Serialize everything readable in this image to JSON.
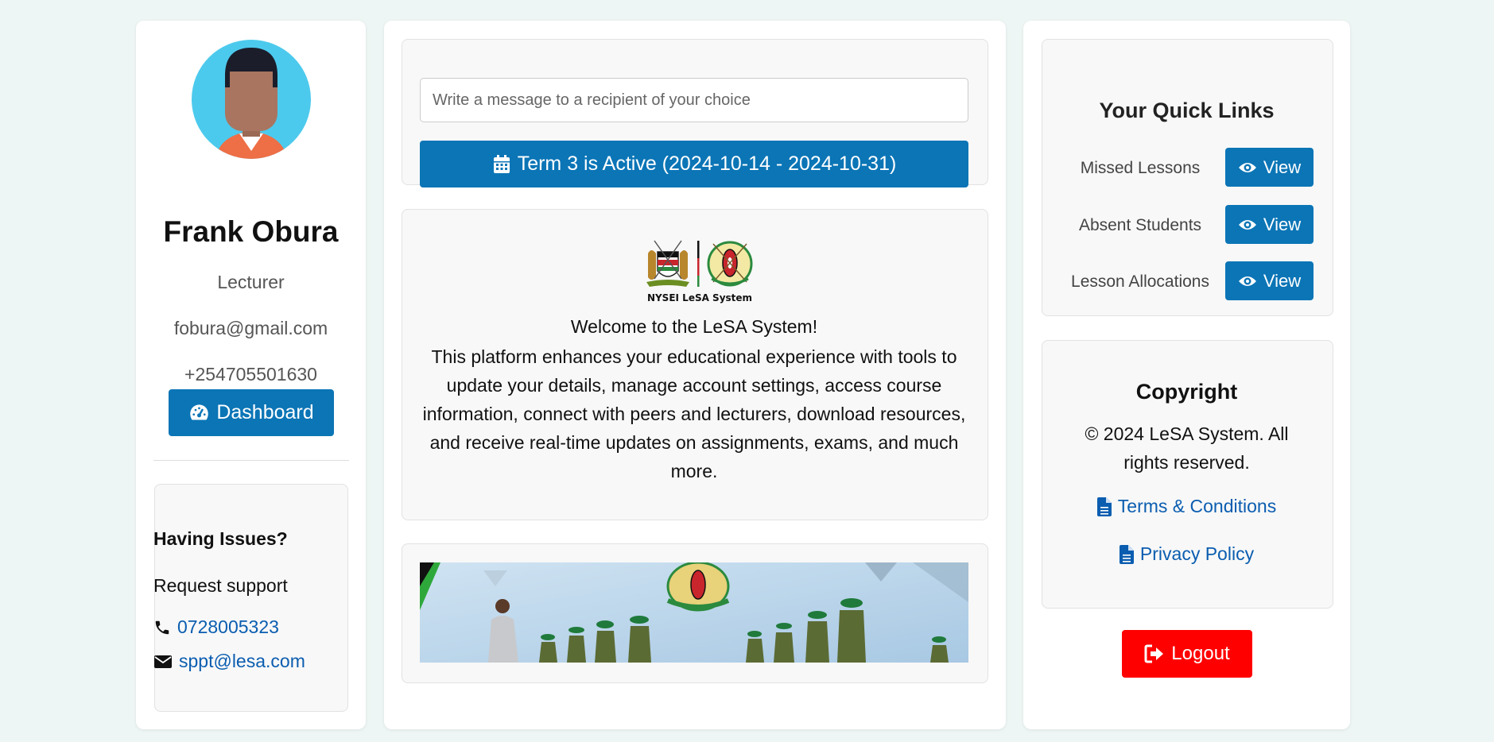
{
  "profile": {
    "name": "Frank Obura",
    "role": "Lecturer",
    "email": "fobura@gmail.com",
    "phone": "+254705501630",
    "dashboard_label": "Dashboard"
  },
  "support": {
    "title": "Having Issues?",
    "subtitle": "Request support",
    "phone": "0728005323",
    "email": "sppt@lesa.com"
  },
  "composer": {
    "placeholder": "Write a message to a recipient of your choice",
    "term_label": "Term 3 is Active (2024-10-14 - 2024-10-31)"
  },
  "welcome": {
    "logo_caption": "NYSEI LeSA System",
    "title": "Welcome to the LeSA System!",
    "body": "This platform enhances your educational experience with tools to update your details, manage account settings, access course information, connect with peers and lecturers, download resources, and receive real-time updates on assignments, exams, and much more."
  },
  "quick_links": {
    "title": "Your Quick Links",
    "items": [
      {
        "label": "Missed Lessons",
        "button": "View"
      },
      {
        "label": "Absent Students",
        "button": "View"
      },
      {
        "label": "Lesson Allocations",
        "button": "View"
      }
    ]
  },
  "copyright": {
    "title": "Copyright",
    "text": "© 2024 LeSA System. All rights reserved.",
    "terms": "Terms & Conditions",
    "privacy": "Privacy Policy"
  },
  "logout_label": "Logout",
  "colors": {
    "primary": "#0b75b6",
    "danger": "#ff0000",
    "link": "#0b5db0",
    "background": "#eef6f5"
  }
}
